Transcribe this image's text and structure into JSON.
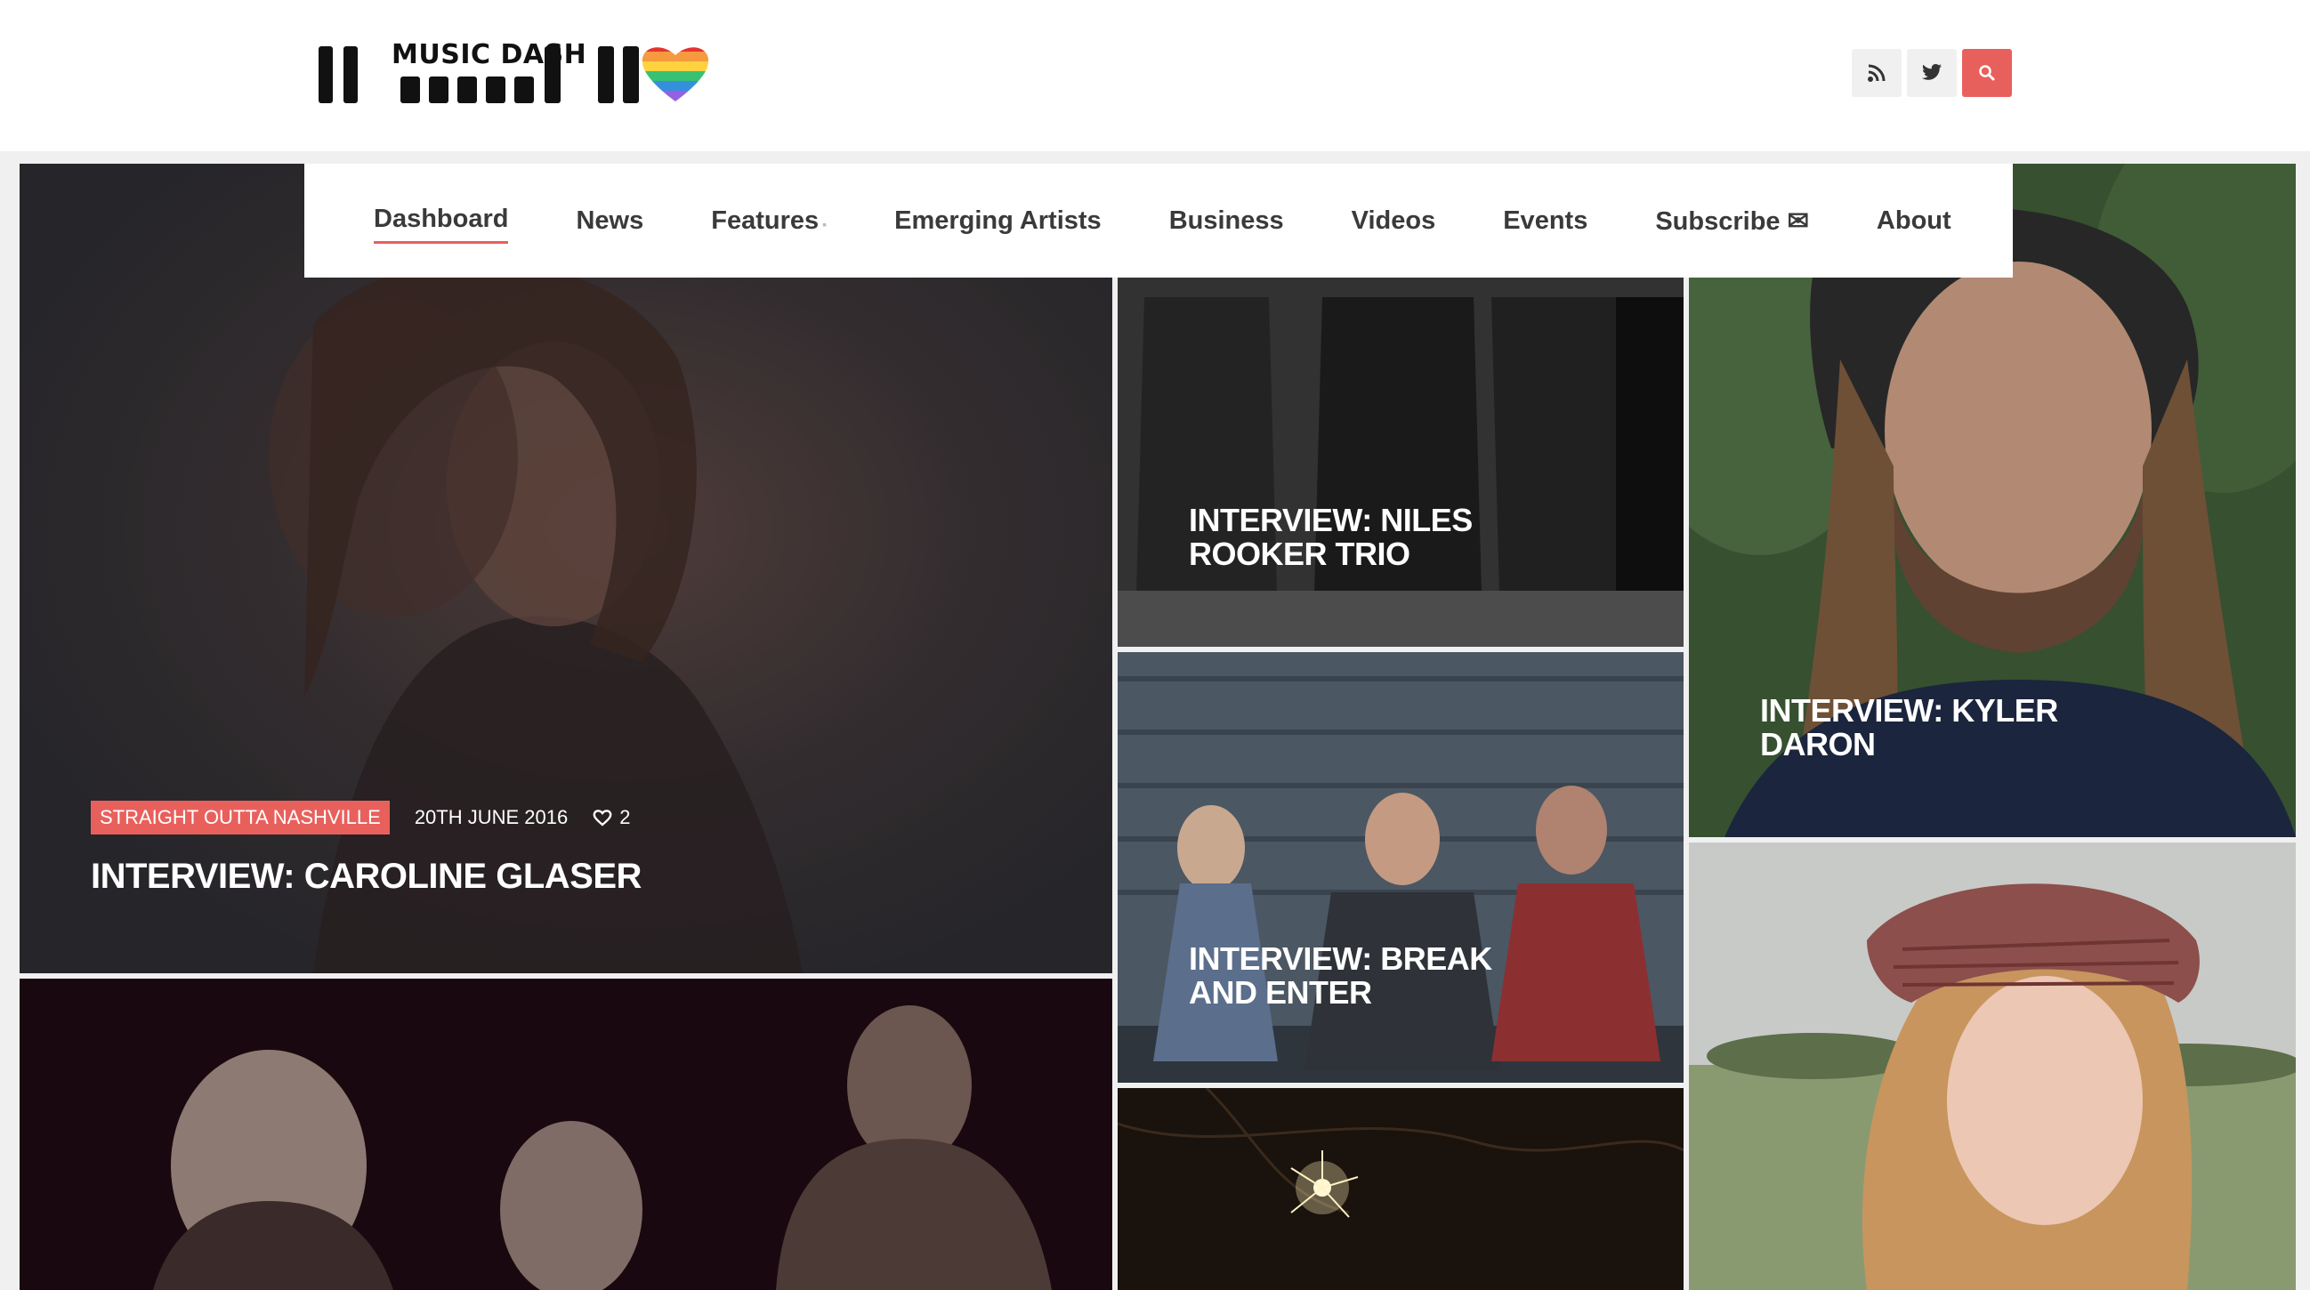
{
  "site": {
    "logo_text": "MUSIC DASH"
  },
  "header_icons": [
    "rss-icon",
    "twitter-icon",
    "search-icon"
  ],
  "colors": {
    "accent": "#e8605c",
    "text": "#3a3a3a"
  },
  "nav": {
    "items": [
      {
        "label": "Dashboard"
      },
      {
        "label": "News"
      },
      {
        "label": "Features"
      },
      {
        "label": "Emerging Artists"
      },
      {
        "label": "Business"
      },
      {
        "label": "Videos"
      },
      {
        "label": "Events"
      },
      {
        "label": "Subscribe ✉"
      },
      {
        "label": "About"
      }
    ]
  },
  "featured": {
    "category": "STRAIGHT OUTTA NASHVILLE",
    "date": "20TH JUNE 2016",
    "likes": "2",
    "title": "INTERVIEW: CAROLINE GLASER"
  },
  "tiles": {
    "niles": {
      "title": "INTERVIEW: NILES ROOKER TRIO"
    },
    "break": {
      "title": "INTERVIEW: BREAK AND ENTER"
    },
    "kyler": {
      "title": "INTERVIEW: KYLER DARON"
    }
  }
}
